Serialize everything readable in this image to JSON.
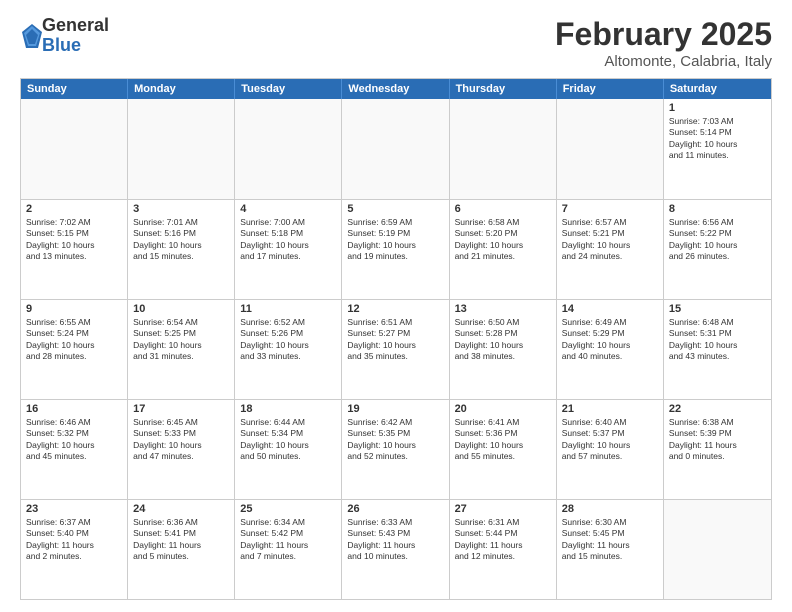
{
  "logo": {
    "general": "General",
    "blue": "Blue"
  },
  "title": {
    "month": "February 2025",
    "location": "Altomonte, Calabria, Italy"
  },
  "calendar": {
    "headers": [
      "Sunday",
      "Monday",
      "Tuesday",
      "Wednesday",
      "Thursday",
      "Friday",
      "Saturday"
    ],
    "rows": [
      [
        {
          "day": "",
          "info": ""
        },
        {
          "day": "",
          "info": ""
        },
        {
          "day": "",
          "info": ""
        },
        {
          "day": "",
          "info": ""
        },
        {
          "day": "",
          "info": ""
        },
        {
          "day": "",
          "info": ""
        },
        {
          "day": "1",
          "info": "Sunrise: 7:03 AM\nSunset: 5:14 PM\nDaylight: 10 hours\nand 11 minutes."
        }
      ],
      [
        {
          "day": "2",
          "info": "Sunrise: 7:02 AM\nSunset: 5:15 PM\nDaylight: 10 hours\nand 13 minutes."
        },
        {
          "day": "3",
          "info": "Sunrise: 7:01 AM\nSunset: 5:16 PM\nDaylight: 10 hours\nand 15 minutes."
        },
        {
          "day": "4",
          "info": "Sunrise: 7:00 AM\nSunset: 5:18 PM\nDaylight: 10 hours\nand 17 minutes."
        },
        {
          "day": "5",
          "info": "Sunrise: 6:59 AM\nSunset: 5:19 PM\nDaylight: 10 hours\nand 19 minutes."
        },
        {
          "day": "6",
          "info": "Sunrise: 6:58 AM\nSunset: 5:20 PM\nDaylight: 10 hours\nand 21 minutes."
        },
        {
          "day": "7",
          "info": "Sunrise: 6:57 AM\nSunset: 5:21 PM\nDaylight: 10 hours\nand 24 minutes."
        },
        {
          "day": "8",
          "info": "Sunrise: 6:56 AM\nSunset: 5:22 PM\nDaylight: 10 hours\nand 26 minutes."
        }
      ],
      [
        {
          "day": "9",
          "info": "Sunrise: 6:55 AM\nSunset: 5:24 PM\nDaylight: 10 hours\nand 28 minutes."
        },
        {
          "day": "10",
          "info": "Sunrise: 6:54 AM\nSunset: 5:25 PM\nDaylight: 10 hours\nand 31 minutes."
        },
        {
          "day": "11",
          "info": "Sunrise: 6:52 AM\nSunset: 5:26 PM\nDaylight: 10 hours\nand 33 minutes."
        },
        {
          "day": "12",
          "info": "Sunrise: 6:51 AM\nSunset: 5:27 PM\nDaylight: 10 hours\nand 35 minutes."
        },
        {
          "day": "13",
          "info": "Sunrise: 6:50 AM\nSunset: 5:28 PM\nDaylight: 10 hours\nand 38 minutes."
        },
        {
          "day": "14",
          "info": "Sunrise: 6:49 AM\nSunset: 5:29 PM\nDaylight: 10 hours\nand 40 minutes."
        },
        {
          "day": "15",
          "info": "Sunrise: 6:48 AM\nSunset: 5:31 PM\nDaylight: 10 hours\nand 43 minutes."
        }
      ],
      [
        {
          "day": "16",
          "info": "Sunrise: 6:46 AM\nSunset: 5:32 PM\nDaylight: 10 hours\nand 45 minutes."
        },
        {
          "day": "17",
          "info": "Sunrise: 6:45 AM\nSunset: 5:33 PM\nDaylight: 10 hours\nand 47 minutes."
        },
        {
          "day": "18",
          "info": "Sunrise: 6:44 AM\nSunset: 5:34 PM\nDaylight: 10 hours\nand 50 minutes."
        },
        {
          "day": "19",
          "info": "Sunrise: 6:42 AM\nSunset: 5:35 PM\nDaylight: 10 hours\nand 52 minutes."
        },
        {
          "day": "20",
          "info": "Sunrise: 6:41 AM\nSunset: 5:36 PM\nDaylight: 10 hours\nand 55 minutes."
        },
        {
          "day": "21",
          "info": "Sunrise: 6:40 AM\nSunset: 5:37 PM\nDaylight: 10 hours\nand 57 minutes."
        },
        {
          "day": "22",
          "info": "Sunrise: 6:38 AM\nSunset: 5:39 PM\nDaylight: 11 hours\nand 0 minutes."
        }
      ],
      [
        {
          "day": "23",
          "info": "Sunrise: 6:37 AM\nSunset: 5:40 PM\nDaylight: 11 hours\nand 2 minutes."
        },
        {
          "day": "24",
          "info": "Sunrise: 6:36 AM\nSunset: 5:41 PM\nDaylight: 11 hours\nand 5 minutes."
        },
        {
          "day": "25",
          "info": "Sunrise: 6:34 AM\nSunset: 5:42 PM\nDaylight: 11 hours\nand 7 minutes."
        },
        {
          "day": "26",
          "info": "Sunrise: 6:33 AM\nSunset: 5:43 PM\nDaylight: 11 hours\nand 10 minutes."
        },
        {
          "day": "27",
          "info": "Sunrise: 6:31 AM\nSunset: 5:44 PM\nDaylight: 11 hours\nand 12 minutes."
        },
        {
          "day": "28",
          "info": "Sunrise: 6:30 AM\nSunset: 5:45 PM\nDaylight: 11 hours\nand 15 minutes."
        },
        {
          "day": "",
          "info": ""
        }
      ]
    ]
  }
}
